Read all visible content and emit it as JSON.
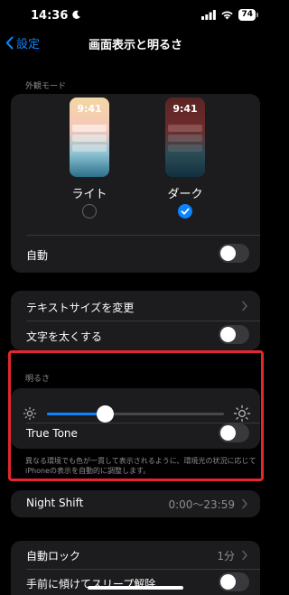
{
  "status": {
    "time": "14:36",
    "battery": "74"
  },
  "nav": {
    "back_label": "設定",
    "title": "画面表示と明るさ"
  },
  "appearance": {
    "section_label": "外観モード",
    "light": {
      "label": "ライト",
      "preview_time": "9:41",
      "selected": false
    },
    "dark": {
      "label": "ダーク",
      "preview_time": "9:41",
      "selected": true
    },
    "auto_label": "自動",
    "auto_on": false
  },
  "text": {
    "text_size_label": "テキストサイズを変更",
    "bold_label": "文字を太くする",
    "bold_on": false
  },
  "brightness": {
    "section_label": "明るさ",
    "level": 0.33,
    "true_tone_label": "True Tone",
    "true_tone_on": false,
    "footnote": "異なる環境でも色が一貫して表示されるように、環境光の状況に応じてiPhoneの表示を自動的に調整します。"
  },
  "night_shift": {
    "label": "Night Shift",
    "value": "0:00〜23:59"
  },
  "lock": {
    "auto_lock_label": "自動ロック",
    "auto_lock_value": "1分",
    "raise_to_wake_label": "手前に傾けてスリープ解除",
    "raise_to_wake_on": false
  },
  "colors": {
    "accent": "#0a84ff",
    "highlight": "#e5252f",
    "card": "#1c1c1e",
    "background": "#000000"
  }
}
